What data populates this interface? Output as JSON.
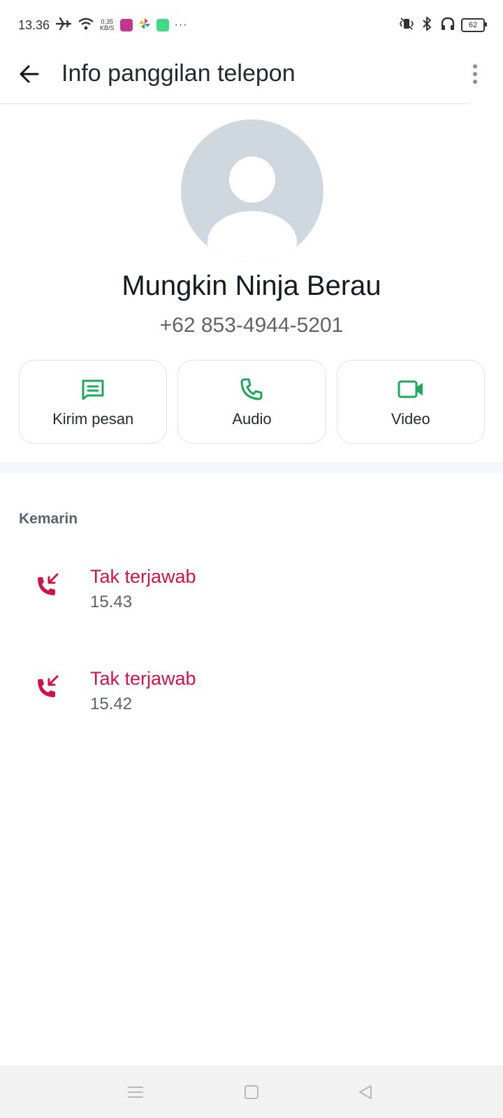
{
  "status_bar": {
    "time": "13.36",
    "net_speed_value": "0.35",
    "net_speed_unit": "KB/S",
    "overflow": "···",
    "battery": "62"
  },
  "app_bar": {
    "title": "Info panggilan telepon"
  },
  "contact": {
    "name": "Mungkin Ninja Berau",
    "phone": "+62 853-4944-5201"
  },
  "actions": [
    {
      "label": "Kirim pesan",
      "icon": "message-icon"
    },
    {
      "label": "Audio",
      "icon": "phone-icon"
    },
    {
      "label": "Video",
      "icon": "video-icon"
    }
  ],
  "history": {
    "section": "Kemarin",
    "calls": [
      {
        "status": "Tak terjawab",
        "time": "15.43",
        "icon": "missed-call-icon"
      },
      {
        "status": "Tak terjawab",
        "time": "15.42",
        "icon": "missed-call-icon"
      }
    ]
  },
  "colors": {
    "accent_green": "#1da85c",
    "missed_red": "#cc1447",
    "avatar_bg": "#cfd8df"
  }
}
